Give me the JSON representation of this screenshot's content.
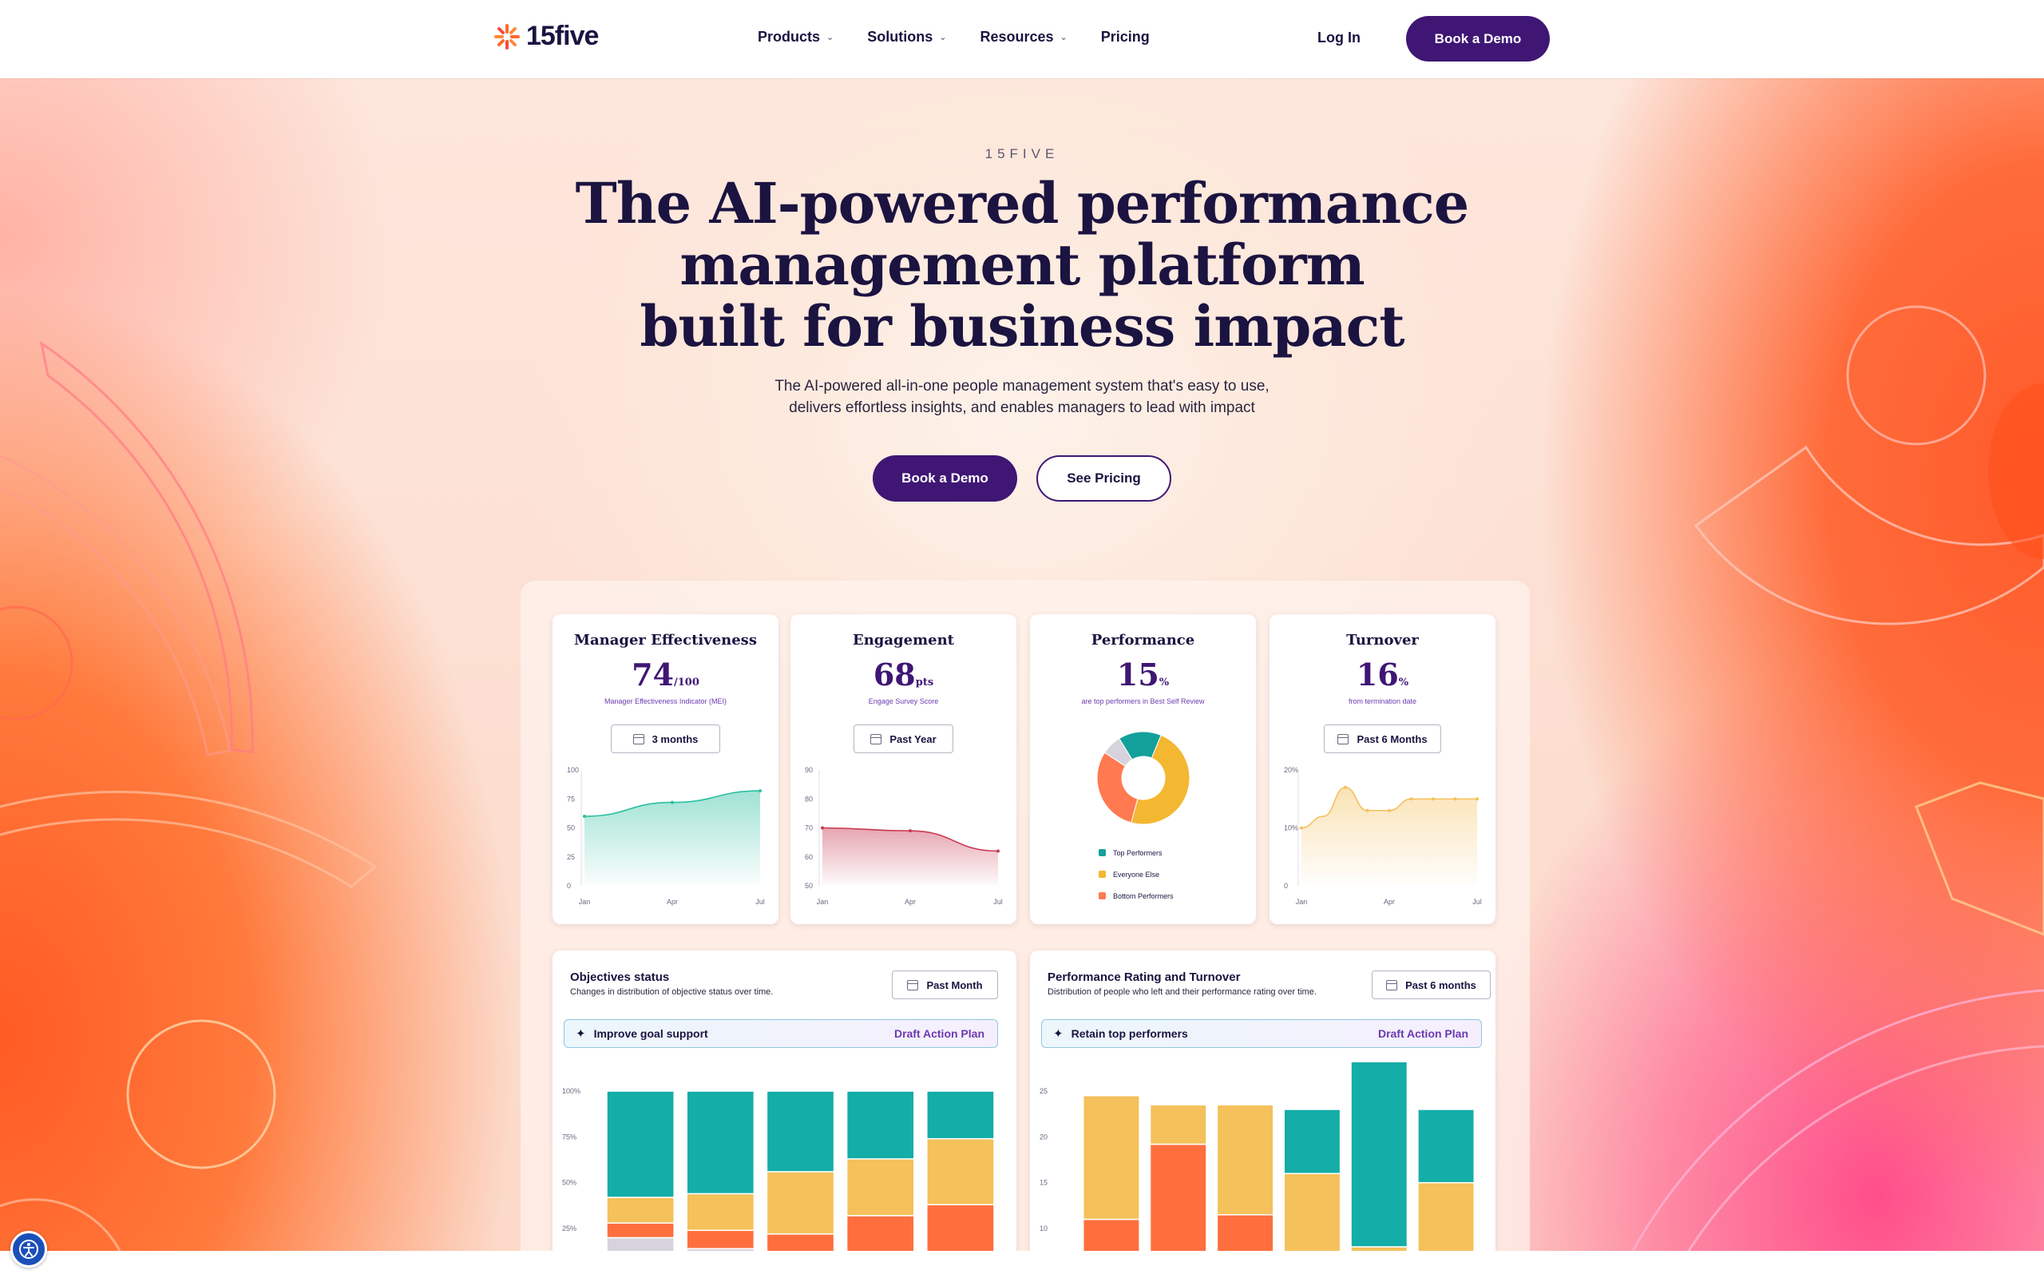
{
  "brand": {
    "logo_text": "15five"
  },
  "nav": {
    "items": [
      {
        "label": "Products",
        "dropdown": true
      },
      {
        "label": "Solutions",
        "dropdown": true
      },
      {
        "label": "Resources",
        "dropdown": true
      },
      {
        "label": "Pricing",
        "dropdown": false
      }
    ],
    "login": "Log In",
    "cta": "Book a Demo"
  },
  "hero": {
    "eyebrow": "15FIVE",
    "headline": [
      "The AI-powered performance",
      "management platform",
      "built for business impact"
    ],
    "subtitle": [
      "The AI-powered all-in-one people management system that's easy to use,",
      "delivers effortless insights, and enables managers to lead with impact"
    ],
    "primary_cta": "Book a Demo",
    "secondary_cta": "See Pricing"
  },
  "colors": {
    "brand_purple": "#3f1674",
    "teal": "#14ada7",
    "yellow": "#f4c15a",
    "orange": "#ff6f3d",
    "gray": "#d6d3dd"
  },
  "dashboard": {
    "cards": [
      {
        "title": "Manager Effectiveness",
        "value": "74",
        "unit": "/100",
        "caption": "Manager Effectiveness Indicator (MEI)",
        "filter": "3 months"
      },
      {
        "title": "Engagement",
        "value": "68",
        "unit": "pts",
        "caption": "Engage Survey Score",
        "filter": "Past Year"
      },
      {
        "title": "Performance",
        "value": "15",
        "unit": "%",
        "caption": "are top performers in Best Self Review"
      },
      {
        "title": "Turnover",
        "value": "16",
        "unit": "%",
        "caption": "from termination date",
        "filter": "Past 6 Months"
      }
    ],
    "objectives": {
      "title": "Objectives status",
      "subtitle": "Changes in distribution of objective status over time.",
      "filter": "Past Month",
      "banner": "Improve goal support",
      "banner_action": "Draft Action Plan"
    },
    "rating": {
      "title": "Performance Rating and Turnover",
      "subtitle": "Distribution of people who left and their performance rating over time.",
      "filter": "Past 6 months",
      "banner": "Retain top performers",
      "banner_action": "Draft Action Plan"
    }
  },
  "chart_data": [
    {
      "type": "area",
      "title": "Manager Effectiveness",
      "x": [
        "Jan",
        "Apr",
        "Jul"
      ],
      "yticks": [
        0,
        25,
        50,
        75,
        100
      ],
      "ylim": [
        0,
        100
      ],
      "series": [
        {
          "values": [
            60,
            72,
            82
          ]
        }
      ],
      "color": "#2bbf9f"
    },
    {
      "type": "area",
      "title": "Engagement",
      "x": [
        "Jan",
        "Apr",
        "Jul"
      ],
      "yticks": [
        50,
        60,
        70,
        80,
        90
      ],
      "ylim": [
        50,
        90
      ],
      "series": [
        {
          "values": [
            70,
            69,
            62
          ]
        }
      ],
      "color": "#c9374f"
    },
    {
      "type": "pie",
      "title": "Performance",
      "labels": [
        "Top Performers",
        "Everyone Else",
        "Bottom Performers",
        "Other"
      ],
      "values": [
        15,
        48,
        30,
        7
      ],
      "colors": [
        "#14a09a",
        "#f4b732",
        "#ff7a50",
        "#d6d3dd"
      ]
    },
    {
      "type": "area",
      "title": "Turnover",
      "x": [
        "Jan",
        "Apr",
        "Jul"
      ],
      "yticks": [
        "0",
        "10%",
        "20%"
      ],
      "ylim": [
        0,
        20
      ],
      "series": [
        {
          "values": [
            10,
            12,
            17,
            13,
            13,
            15,
            15,
            15,
            15
          ]
        }
      ],
      "color": "#f4c15a"
    },
    {
      "type": "bar",
      "stacked": true,
      "title": "Objectives status",
      "yticks": [
        "25%",
        "50%",
        "75%",
        "100%"
      ],
      "ylim": [
        0,
        100
      ],
      "series_colors": [
        "#d6d3dd",
        "#ff6f3d",
        "#f4c15a",
        "#14ada7"
      ],
      "bars": [
        [
          20,
          8,
          14,
          58
        ],
        [
          14,
          10,
          20,
          56
        ],
        [
          0,
          22,
          34,
          44
        ],
        [
          0,
          32,
          31,
          37
        ],
        [
          0,
          38,
          36,
          26
        ]
      ]
    },
    {
      "type": "bar",
      "stacked": true,
      "title": "Performance Rating and Turnover",
      "yticks": [
        "10",
        "15",
        "20",
        "25"
      ],
      "ylim": [
        5,
        25
      ],
      "series_colors": [
        "#d6d3dd",
        "#ff6f3d",
        "#f4c15a",
        "#14ada7"
      ],
      "bars": [
        [
          0,
          6,
          13.5,
          0
        ],
        [
          0,
          14.2,
          4.3,
          0
        ],
        [
          1.5,
          5,
          12,
          0
        ],
        [
          0,
          0,
          11,
          7
        ],
        [
          0,
          0,
          3,
          21
        ],
        [
          0,
          0,
          10,
          8
        ]
      ]
    }
  ]
}
